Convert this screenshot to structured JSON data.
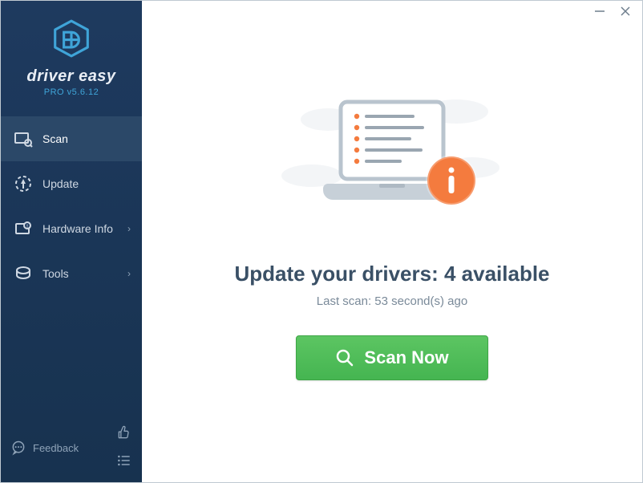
{
  "brand": {
    "name": "driver easy",
    "version": "PRO v5.6.12"
  },
  "sidebar": {
    "items": [
      {
        "label": "Scan"
      },
      {
        "label": "Update"
      },
      {
        "label": "Hardware Info"
      },
      {
        "label": "Tools"
      }
    ],
    "feedback_label": "Feedback"
  },
  "main": {
    "headline": "Update your drivers: 4 available",
    "subline": "Last scan: 53 second(s) ago",
    "scan_button": "Scan Now"
  },
  "colors": {
    "accent_green": "#4fbf57",
    "accent_orange": "#f47b3e",
    "sidebar_bg": "#1e3a5f",
    "text_dark": "#3a5066"
  }
}
